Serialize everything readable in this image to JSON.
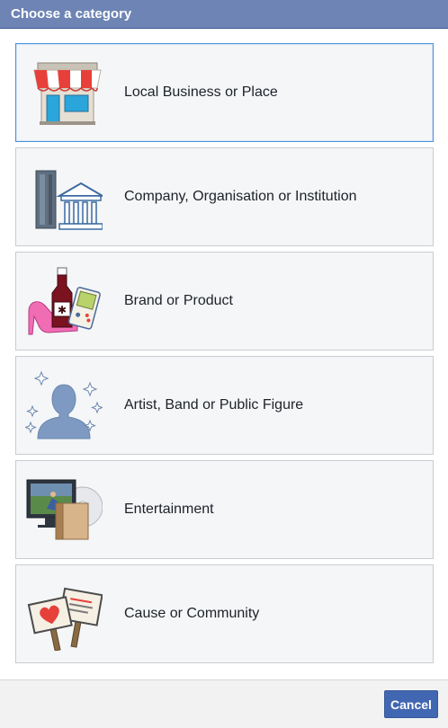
{
  "dialog": {
    "title": "Choose a category"
  },
  "categories": [
    {
      "label": "Local Business or Place",
      "icon": "storefront-icon",
      "selected": true
    },
    {
      "label": "Company, Organisation or Institution",
      "icon": "buildings-icon",
      "selected": false
    },
    {
      "label": "Brand or Product",
      "icon": "products-icon",
      "selected": false
    },
    {
      "label": "Artist, Band or Public Figure",
      "icon": "person-silhouette-icon",
      "selected": false
    },
    {
      "label": "Entertainment",
      "icon": "entertainment-icon",
      "selected": false
    },
    {
      "label": "Cause or Community",
      "icon": "protest-signs-icon",
      "selected": false
    }
  ],
  "footer": {
    "cancel_label": "Cancel"
  },
  "colors": {
    "header_bg": "#6d84b4",
    "selected_border": "#4a90e2",
    "card_bg": "#f5f6f7",
    "button_bg": "#4267b2"
  }
}
